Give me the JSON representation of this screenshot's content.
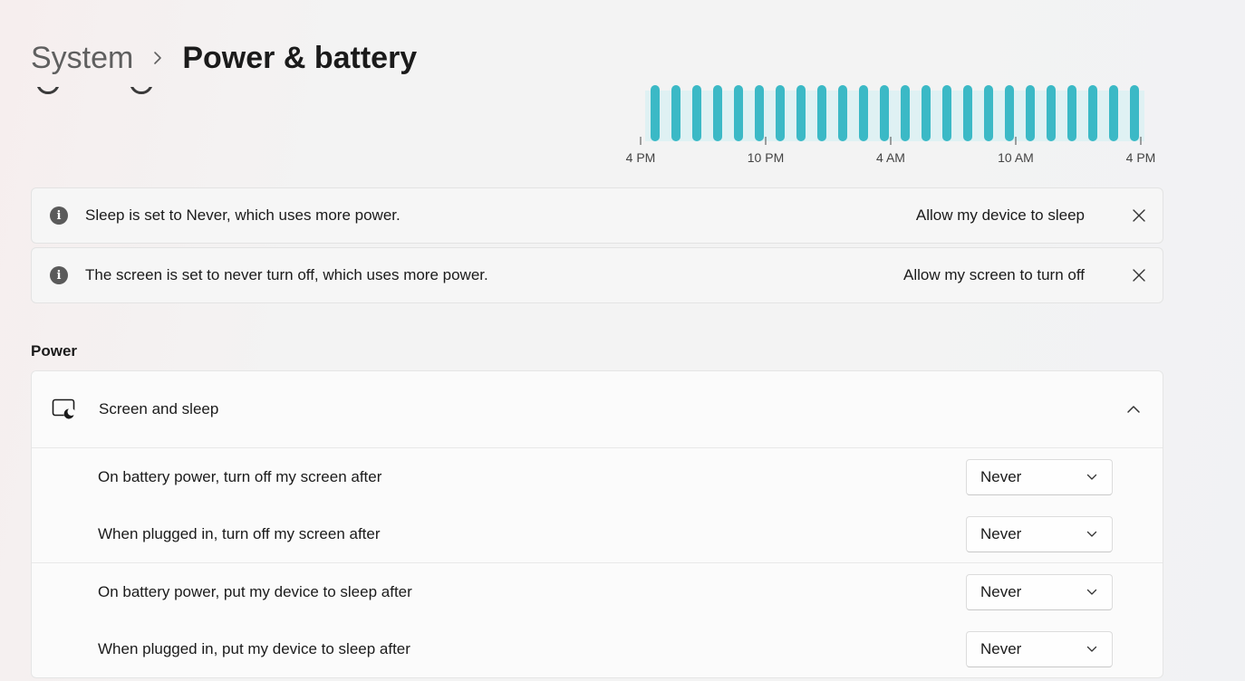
{
  "breadcrumb": {
    "root": "System",
    "current": "Power & battery"
  },
  "usage_chart": {
    "bar_color": "#3bb9c6",
    "bar_track_color": "#dff1f3",
    "tick_labels": [
      "4 PM",
      "10 PM",
      "4 AM",
      "10 AM",
      "4 PM"
    ],
    "bar_count": 24,
    "bar_levels": [
      1,
      1,
      1,
      1,
      1,
      1,
      1,
      1,
      1,
      1,
      1,
      1,
      1,
      1,
      1,
      1,
      1,
      1,
      1,
      1,
      1,
      1,
      1,
      1
    ]
  },
  "notices": [
    {
      "message": "Sleep is set to Never, which uses more power.",
      "action": "Allow my device to sleep",
      "icon": "info-icon",
      "close_icon": "close-icon"
    },
    {
      "message": "The screen is set to never turn off, which uses more power.",
      "action": "Allow my screen to turn off",
      "icon": "info-icon",
      "close_icon": "close-icon"
    }
  ],
  "power_section": {
    "title": "Power",
    "screen_and_sleep": {
      "title": "Screen and sleep",
      "icon": "screen-sleep-icon",
      "expanded": true,
      "settings": [
        {
          "label": "On battery power, turn off my screen after",
          "value": "Never"
        },
        {
          "label": "When plugged in, turn off my screen after",
          "value": "Never"
        },
        {
          "label": "On battery power, put my device to sleep after",
          "value": "Never"
        },
        {
          "label": "When plugged in, put my device to sleep after",
          "value": "Never"
        }
      ]
    }
  }
}
